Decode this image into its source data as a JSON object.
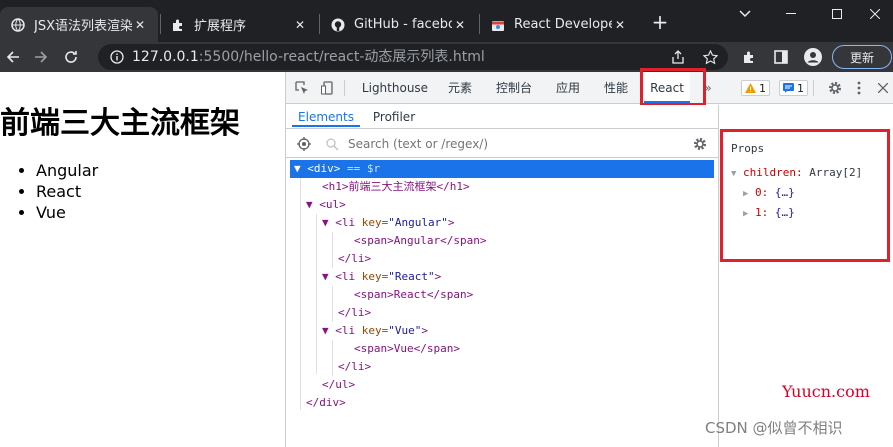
{
  "window": {
    "tabs": [
      {
        "title": "JSX语法列表渲染",
        "icon": "globe-icon",
        "active": true
      },
      {
        "title": "扩展程序",
        "icon": "puzzle-icon",
        "active": false
      },
      {
        "title": "GitHub - facebo",
        "icon": "github-icon",
        "active": false
      },
      {
        "title": "React Developer",
        "icon": "react-store-icon",
        "active": false
      }
    ],
    "new_tab": "+",
    "close": "✕"
  },
  "toolbar": {
    "url_host": "127.0.0.1",
    "url_rest": ":5500/hello-react/react-动态展示列表.html",
    "update_label": "更新"
  },
  "page": {
    "heading": "前端三大主流框架",
    "items": [
      "Angular",
      "React",
      "Vue"
    ]
  },
  "devtools": {
    "tabs": [
      "Lighthouse",
      "元素",
      "控制台",
      "应用",
      "性能",
      "React"
    ],
    "more": "»",
    "warnings": "1",
    "messages": "1",
    "subtabs": [
      "Elements",
      "Profiler"
    ],
    "search_placeholder": "Search (text or /regex/)",
    "tree": {
      "root_open": "▼ <div>",
      "root_eq": " == $r",
      "h1_line": "<h1>前端三大主流框架</h1>",
      "ul_open": "▼ <ul>",
      "li": [
        {
          "key_label": "key=",
          "key_value": "\"Angular\"",
          "span": "<span>Angular</span>"
        },
        {
          "key_label": "key=",
          "key_value": "\"React\"",
          "span": "<span>React</span>"
        },
        {
          "key_label": "key=",
          "key_value": "\"Vue\"",
          "span": "<span>Vue</span>"
        }
      ],
      "li_open": "▼ <li ",
      "li_gt": ">",
      "li_close": "</li>",
      "ul_close": "</ul>",
      "div_close": "</div>"
    },
    "props": {
      "title": "Props",
      "children_label": "children:",
      "children_value": "Array[2]",
      "entries": [
        {
          "key": "0:",
          "value": "{…}"
        },
        {
          "key": "1:",
          "value": "{…}"
        }
      ]
    }
  },
  "watermarks": {
    "site": "Yuucn.com",
    "csdn": "CSDN @似曾不相识"
  },
  "colors": {
    "highlight_red": "#e0202a",
    "selected_blue": "#1a73e8"
  }
}
